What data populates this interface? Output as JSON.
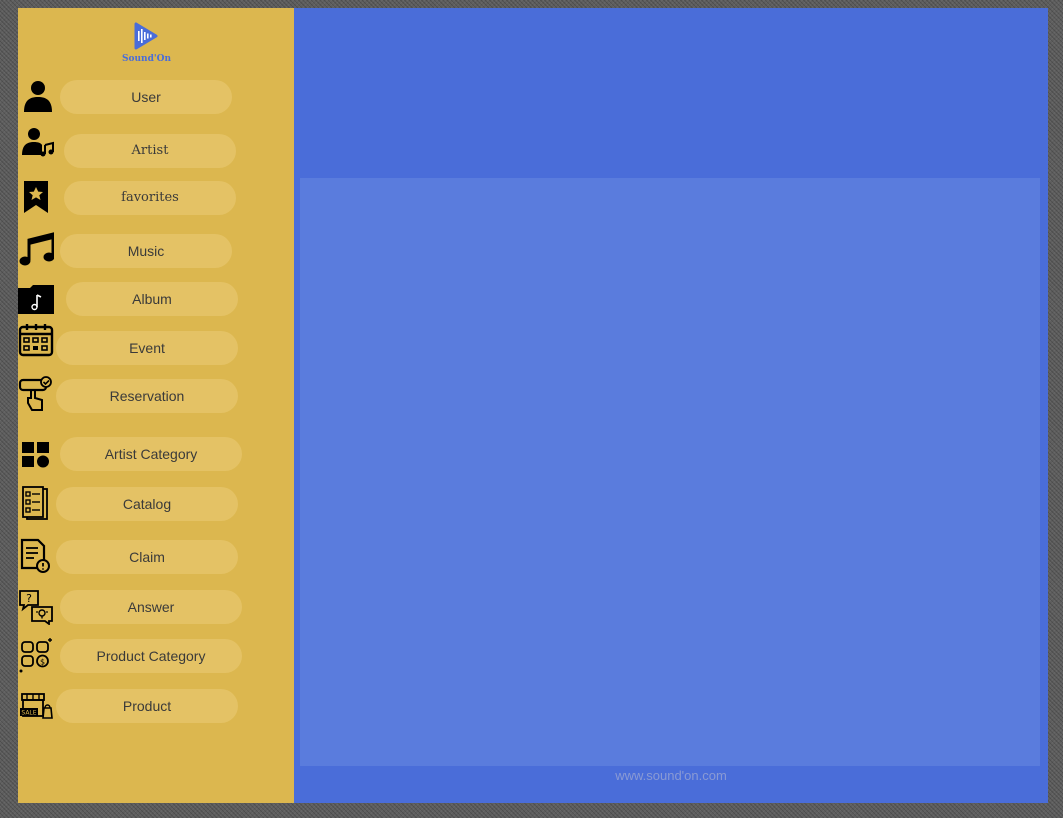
{
  "brand": {
    "name": "Sound'On",
    "logo_icon": "play-soundwave-icon",
    "accent_color": "#4a6dd9"
  },
  "sidebar": {
    "background": "#dcb74f",
    "items": [
      {
        "label": "User",
        "icon": "user-icon"
      },
      {
        "label": "Artist",
        "icon": "artist-icon"
      },
      {
        "label": "favorites",
        "icon": "bookmark-star-icon"
      },
      {
        "label": "Music",
        "icon": "music-note-icon"
      },
      {
        "label": "Album",
        "icon": "album-folder-icon"
      },
      {
        "label": "Event",
        "icon": "calendar-icon"
      },
      {
        "label": "Reservation",
        "icon": "reservation-touch-icon"
      },
      {
        "label": "Artist Category",
        "icon": "category-grid-icon"
      },
      {
        "label": "Catalog",
        "icon": "catalog-icon"
      },
      {
        "label": "Claim",
        "icon": "claim-document-icon"
      },
      {
        "label": "Answer",
        "icon": "question-answer-icon"
      },
      {
        "label": "Product Category",
        "icon": "product-category-icon"
      },
      {
        "label": "Product",
        "icon": "shop-product-icon"
      }
    ]
  },
  "main": {
    "background": "#4a6dd9",
    "panel_color": "#5a7cdd"
  },
  "footer": {
    "text": "www.sound'on.com"
  }
}
